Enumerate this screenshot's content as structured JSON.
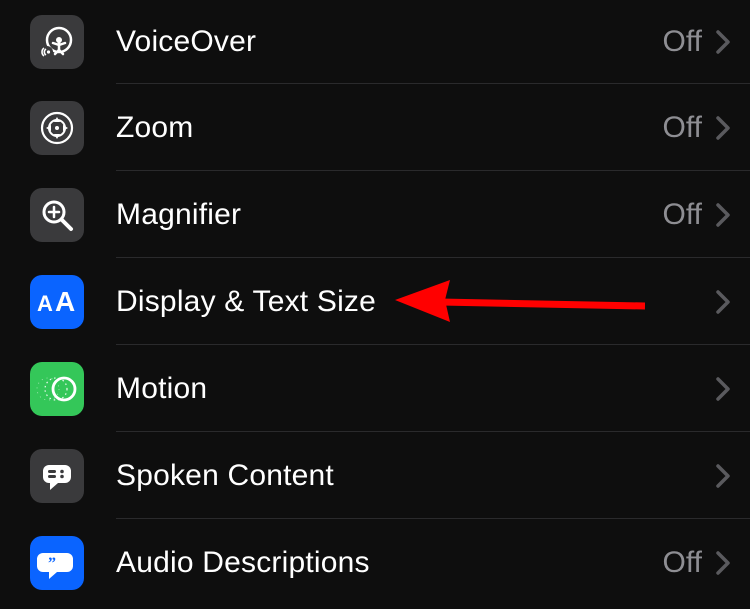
{
  "items": [
    {
      "key": "voiceover",
      "label": "VoiceOver",
      "status": "Off",
      "iconBg": "#3a3a3c",
      "glyph": "voiceover"
    },
    {
      "key": "zoom",
      "label": "Zoom",
      "status": "Off",
      "iconBg": "#3a3a3c",
      "glyph": "zoom"
    },
    {
      "key": "magnifier",
      "label": "Magnifier",
      "status": "Off",
      "iconBg": "#3a3a3c",
      "glyph": "magnifier"
    },
    {
      "key": "display",
      "label": "Display & Text Size",
      "status": "",
      "iconBg": "#0a64ff",
      "glyph": "aa"
    },
    {
      "key": "motion",
      "label": "Motion",
      "status": "",
      "iconBg": "#34c759",
      "glyph": "motion"
    },
    {
      "key": "spoken",
      "label": "Spoken Content",
      "status": "",
      "iconBg": "#3a3a3c",
      "glyph": "spoken"
    },
    {
      "key": "audiodesc",
      "label": "Audio Descriptions",
      "status": "Off",
      "iconBg": "#0a64ff",
      "glyph": "audiodesc"
    }
  ],
  "annotation": {
    "target": "display",
    "colorHex": "#ff0000"
  }
}
